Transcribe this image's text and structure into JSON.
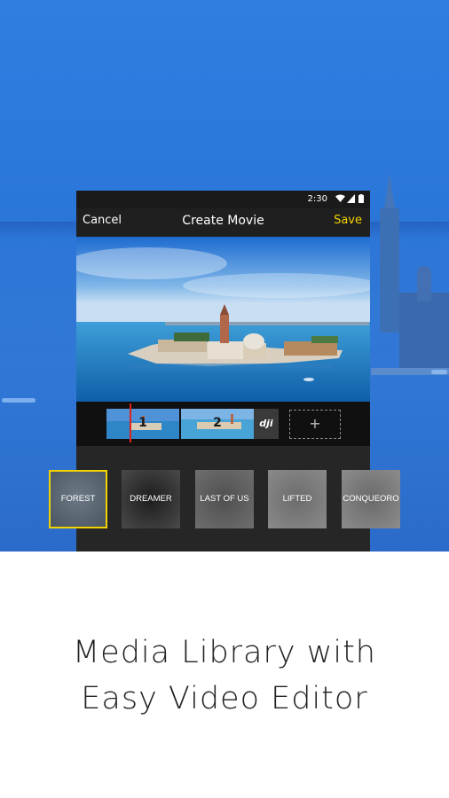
{
  "status_bar": {
    "time": "2:30"
  },
  "app_bar": {
    "cancel_label": "Cancel",
    "title": "Create Movie",
    "save_label": "Save"
  },
  "timeline": {
    "clips": [
      {
        "number": "1"
      },
      {
        "number": "2"
      }
    ],
    "watermark": "dji",
    "add_label": "+"
  },
  "filters": [
    {
      "label": "FOREST",
      "selected": true
    },
    {
      "label": "DREAMER",
      "selected": false
    },
    {
      "label": "LAST OF US",
      "selected": false
    },
    {
      "label": "LIFTED",
      "selected": false
    },
    {
      "label": "CONQUEORO",
      "selected": false
    }
  ],
  "caption": {
    "line1": "Media Library with",
    "line2": "Easy Video Editor"
  },
  "colors": {
    "accent": "#f5d300",
    "hero_blue": "#2a76d9",
    "playhead": "#e0231c"
  }
}
